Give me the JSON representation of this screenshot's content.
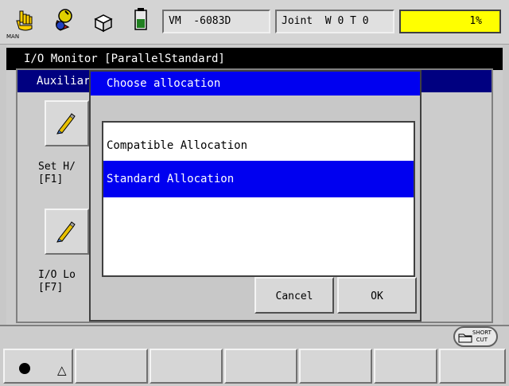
{
  "status_bar": {
    "mode_label": "MAN",
    "program_label": "VM  -6083D",
    "coord_label": "Joint  W 0 T 0",
    "speed_label": "1%"
  },
  "window": {
    "title": "I/O Monitor [ParallelStandard]"
  },
  "aux_panel": {
    "title": "Auxiliar",
    "buttons": [
      {
        "label": "Set H/\n[F1]"
      },
      {
        "label": "I/O Lo\n[F7]"
      }
    ]
  },
  "dialog": {
    "title": "Choose allocation",
    "options": [
      {
        "label": "Compatible Allocation",
        "selected": false
      },
      {
        "label": "Standard Allocation",
        "selected": true
      }
    ],
    "cancel_label": "Cancel",
    "ok_label": "OK"
  },
  "bottom": {
    "shortcut_label": "SHORT\nCUT"
  },
  "colors": {
    "title_bar": "#000000",
    "aux_title": "#000080",
    "dialog_title": "#0000f0",
    "selected_item": "#0000f0",
    "speed_box": "#ffff00"
  }
}
